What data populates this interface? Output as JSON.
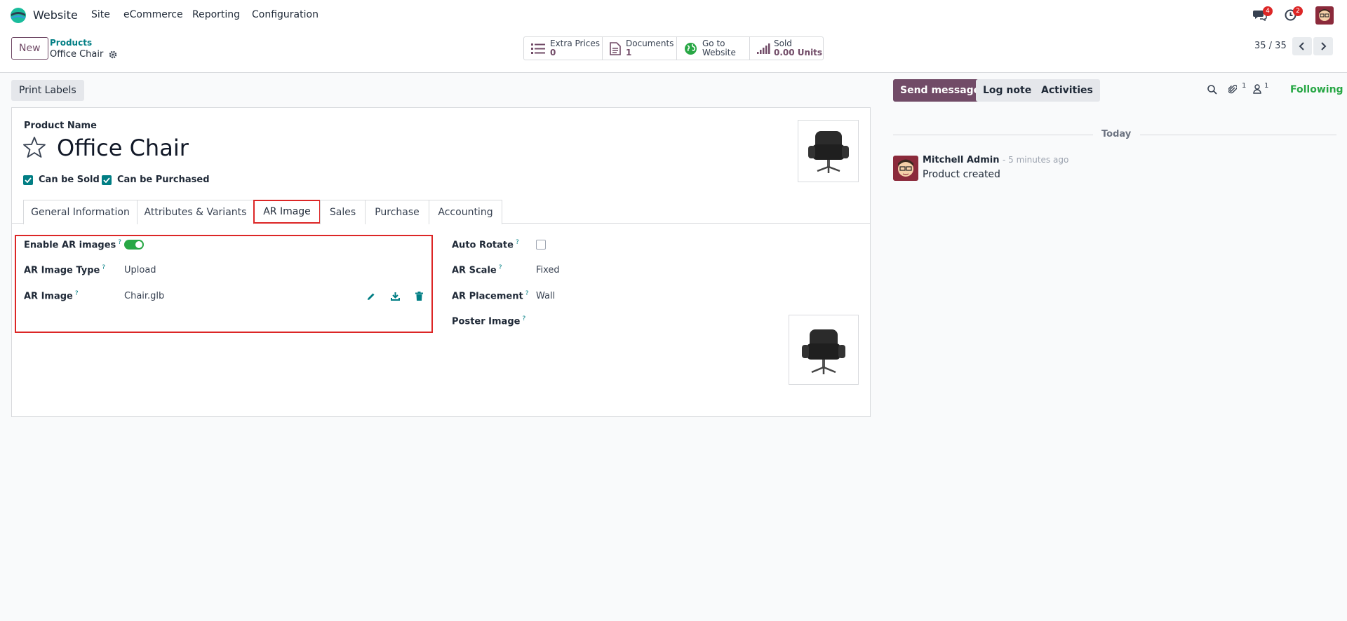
{
  "navbar": {
    "app_name": "Website",
    "menu": [
      "Site",
      "eCommerce",
      "Reporting",
      "Configuration"
    ],
    "messages_count": "4",
    "activities_count": "2"
  },
  "control_panel": {
    "new_label": "New",
    "breadcrumb_parent": "Products",
    "breadcrumb_current": "Office Chair",
    "smart_buttons": [
      {
        "label": "Extra Prices",
        "value": "0",
        "icon": "list-icon"
      },
      {
        "label": "Documents",
        "value": "1",
        "icon": "document-icon"
      },
      {
        "label": "Go to",
        "value": "Website",
        "icon": "globe-icon"
      },
      {
        "label": "Sold",
        "value": "0.00 Units",
        "icon": "signal-bars-icon"
      }
    ],
    "pager": "35 / 35"
  },
  "form": {
    "print_labels": "Print Labels",
    "product_name_label": "Product Name",
    "product_name": "Office Chair",
    "can_be_sold": "Can be Sold",
    "can_be_purchased": "Can be Purchased",
    "tabs": [
      "General Information",
      "Attributes & Variants",
      "AR Image",
      "Sales",
      "Purchase",
      "Accounting"
    ],
    "active_tab": "AR Image",
    "left_fields": [
      {
        "label": "Enable AR images",
        "value": ""
      },
      {
        "label": "AR Image Type",
        "value": "Upload"
      },
      {
        "label": "AR Image",
        "value": "Chair.glb"
      }
    ],
    "right_fields": [
      {
        "label": "Auto Rotate",
        "value": ""
      },
      {
        "label": "AR Scale",
        "value": "Fixed"
      },
      {
        "label": "AR Placement",
        "value": "Wall"
      },
      {
        "label": "Poster Image",
        "value": ""
      }
    ],
    "help_mark": "?",
    "enable_ar_images": true,
    "auto_rotate": false
  },
  "chatter": {
    "send_message": "Send message",
    "log_note": "Log note",
    "activities": "Activities",
    "attachments_count": "1",
    "followers_count": "1",
    "following": "Following",
    "today": "Today",
    "message": {
      "author": "Mitchell Admin",
      "time": "- 5 minutes ago",
      "body": "Product created"
    }
  },
  "colors": {
    "brand": "#714b67",
    "teal": "#017e84",
    "highlight": "#dc2626",
    "following": "#28a745"
  }
}
